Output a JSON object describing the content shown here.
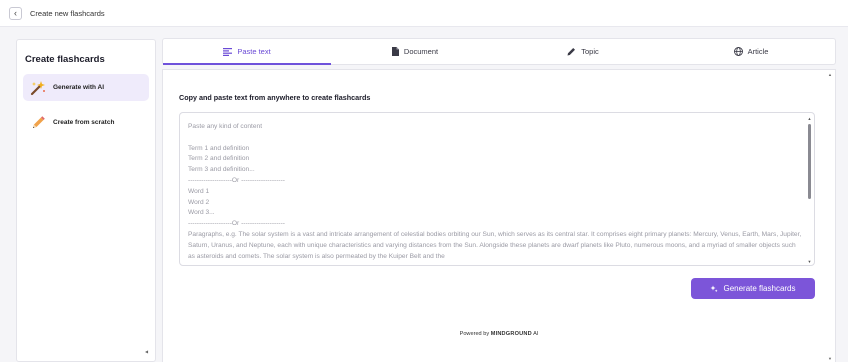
{
  "topbar": {
    "back_icon": "chevron-left-icon",
    "title": "Create new flashcards"
  },
  "sidebar": {
    "title": "Create flashcards",
    "items": [
      {
        "label": "Generate with AI",
        "icon": "magic-wand-icon",
        "active": true
      },
      {
        "label": "Create from scratch",
        "icon": "pencil-icon",
        "active": false
      }
    ]
  },
  "tabs": [
    {
      "label": "Paste text",
      "icon": "text-align-icon",
      "active": true
    },
    {
      "label": "Document",
      "icon": "document-icon",
      "active": false
    },
    {
      "label": "Topic",
      "icon": "pencil-icon",
      "active": false
    },
    {
      "label": "Article",
      "icon": "globe-icon",
      "active": false
    }
  ],
  "main": {
    "instruction": "Copy and paste text from anywhere to create flashcards",
    "textarea_placeholder": "Paste any kind of content\n\nTerm 1 and definition\nTerm 2 and definition\nTerm 3 and definition...\n--------------------Or --------------------\nWord 1\nWord 2\nWord 3...\n--------------------Or --------------------\nParagraphs, e.g. The solar system is a vast and intricate arrangement of celestial bodies orbiting our Sun, which serves as its central star. It comprises eight primary planets: Mercury, Venus, Earth, Mars, Jupiter, Saturn, Uranus, and Neptune, each with unique characteristics and varying distances from the Sun. Alongside these planets are dwarf planets like Pluto, numerous moons, and a myriad of smaller objects such as asteroids and comets. The solar system is also permeated by the Kuiper Belt and the",
    "generate_button": "Generate flashcards",
    "powered_prefix": "Powered by",
    "powered_brand": "MINDGROUND",
    "powered_suffix": "AI"
  },
  "colors": {
    "accent": "#7c55d9",
    "active_bg": "#efebfb",
    "canvas_bg": "#f5f5f8"
  }
}
